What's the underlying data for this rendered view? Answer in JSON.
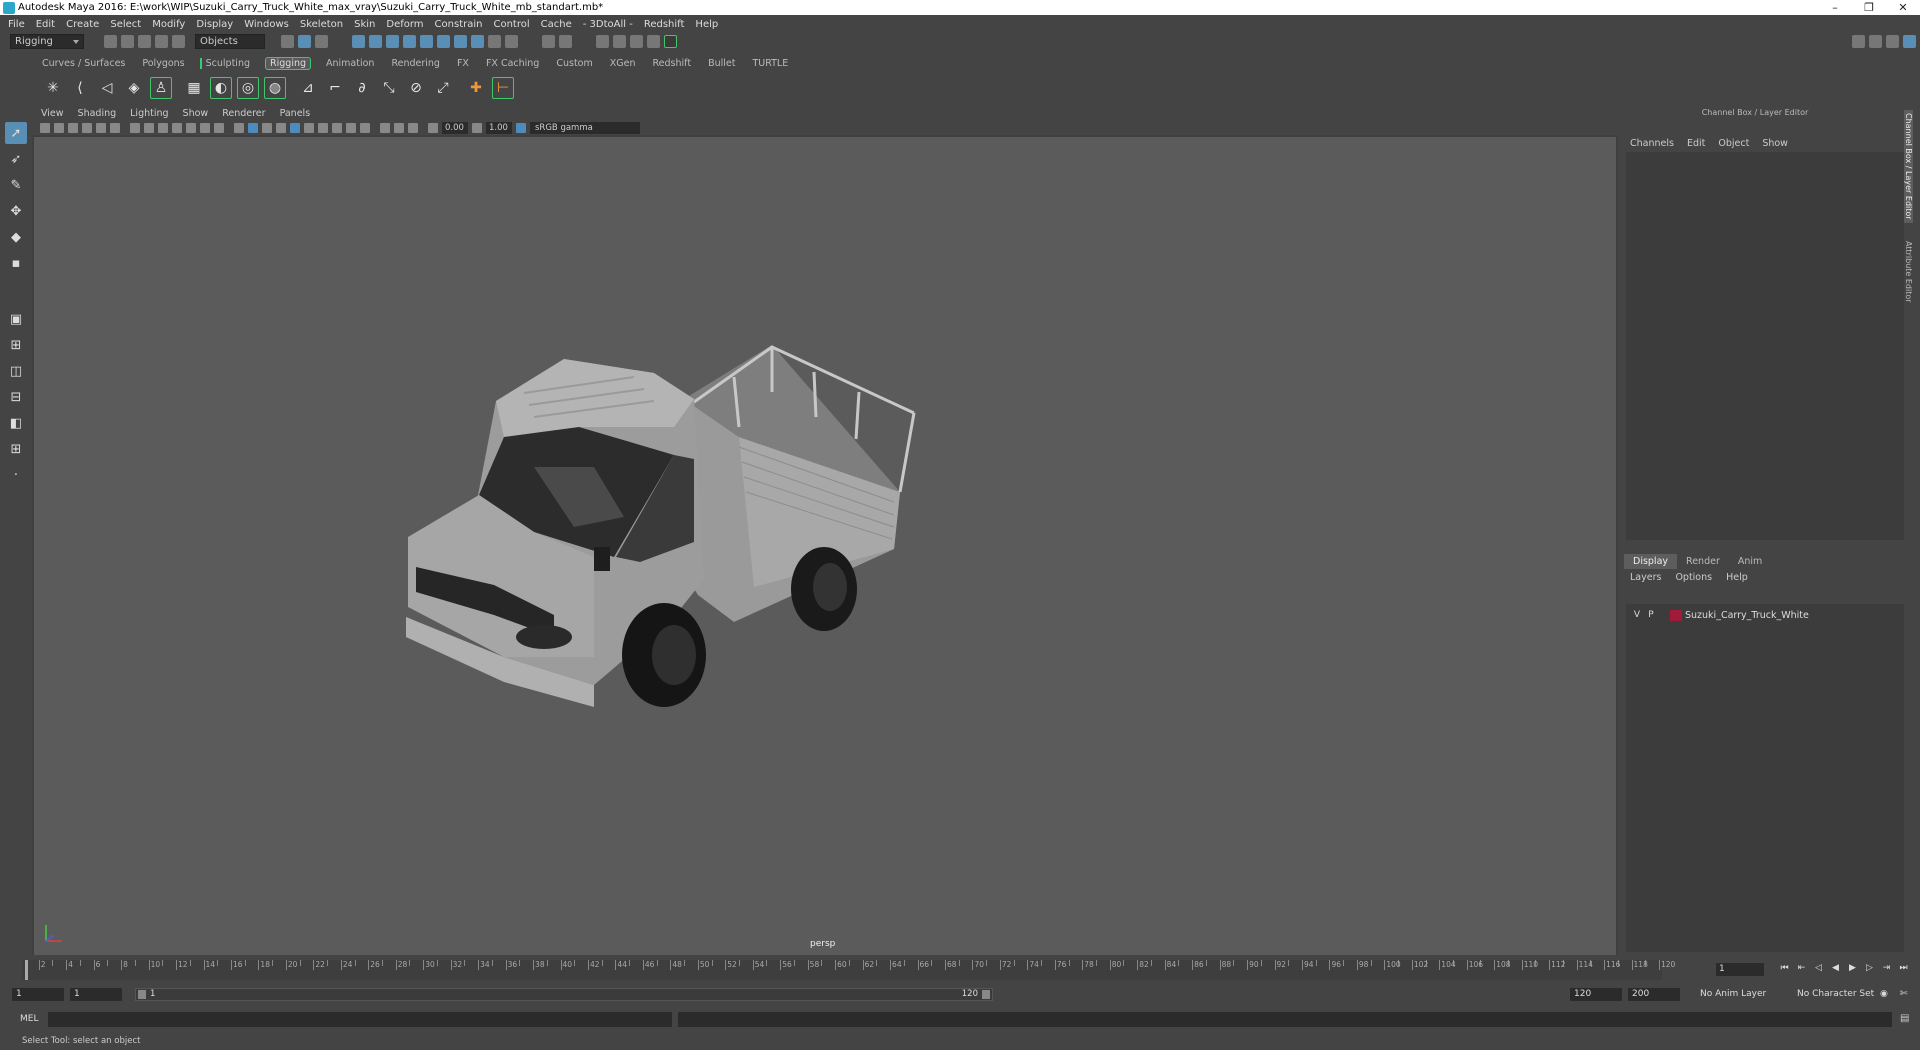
{
  "window": {
    "title": "Autodesk Maya 2016: E:\\work\\WIP\\Suzuki_Carry_Truck_White_max_vray\\Suzuki_Carry_Truck_White_mb_standart.mb*",
    "minimize": "–",
    "restore": "❐",
    "close": "✕"
  },
  "menubar": [
    "File",
    "Edit",
    "Create",
    "Select",
    "Modify",
    "Display",
    "Windows",
    "Skeleton",
    "Skin",
    "Deform",
    "Constrain",
    "Control",
    "Cache",
    "- 3DtoAll -",
    "Redshift",
    "Help"
  ],
  "statusline": {
    "menu_set": "Rigging",
    "selection_mode": "Objects"
  },
  "shelf_tabs": [
    {
      "label": "Curves / Surfaces"
    },
    {
      "label": "Polygons"
    },
    {
      "label": "Sculpting"
    },
    {
      "label": "Rigging",
      "active": true
    },
    {
      "label": "Animation"
    },
    {
      "label": "Rendering"
    },
    {
      "label": "FX"
    },
    {
      "label": "FX Caching"
    },
    {
      "label": "Custom"
    },
    {
      "label": "XGen"
    },
    {
      "label": "Redshift"
    },
    {
      "label": "Bullet"
    },
    {
      "label": "TURTLE"
    }
  ],
  "viewport": {
    "menu": [
      "View",
      "Shading",
      "Lighting",
      "Show",
      "Renderer",
      "Panels"
    ],
    "exposure": "0.00",
    "gamma": "1.00",
    "color_space": "sRGB gamma",
    "camera": "persp"
  },
  "channel_box": {
    "title": "Channel Box / Layer Editor",
    "menu": [
      "Channels",
      "Edit",
      "Object",
      "Show"
    ]
  },
  "layer_editor": {
    "tabs": [
      "Display",
      "Render",
      "Anim"
    ],
    "menu": [
      "Layers",
      "Options",
      "Help"
    ],
    "layer": {
      "v": "V",
      "p": "P",
      "name": "Suzuki_Carry_Truck_White",
      "color": "#a11a3a"
    }
  },
  "side_tabs": [
    "Channel Box / Layer Editor",
    "Attribute Editor"
  ],
  "timeline": {
    "labels": [
      "2",
      "4",
      "6",
      "8",
      "10",
      "12",
      "14",
      "16",
      "18",
      "20",
      "22",
      "24",
      "26",
      "28",
      "30",
      "32",
      "34",
      "36",
      "38",
      "40",
      "42",
      "44",
      "46",
      "48",
      "50",
      "52",
      "54",
      "56",
      "58",
      "60",
      "62",
      "64",
      "66",
      "68",
      "70",
      "72",
      "74",
      "76",
      "78",
      "80",
      "82",
      "84",
      "86",
      "88",
      "90",
      "92",
      "94",
      "96",
      "98",
      "100",
      "102",
      "104",
      "106",
      "108",
      "110",
      "112",
      "114",
      "116",
      "118",
      "120"
    ],
    "current_frame": "1"
  },
  "range": {
    "start": "1",
    "playback_start": "1",
    "slider_start": "1",
    "slider_end": "120",
    "playback_end": "120",
    "end": "200",
    "anim_layer": "No Anim Layer",
    "character_set": "No Character Set"
  },
  "command": {
    "mel": "MEL"
  },
  "help_line": "Select Tool: select an object"
}
